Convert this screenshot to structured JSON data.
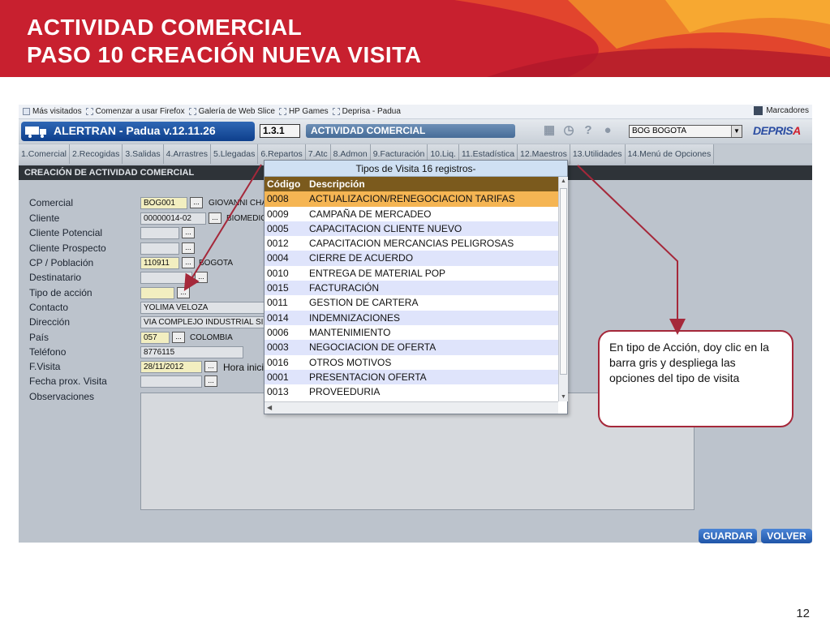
{
  "slide": {
    "title_line1": "ACTIVIDAD COMERCIAL",
    "title_line2": "PASO 10 CREACIÓN NUEVA VISITA",
    "page_number": "12"
  },
  "bookmarks": {
    "items": [
      "Más visitados",
      "Comenzar a usar Firefox",
      "Galería de Web Slice",
      "HP Games",
      "Deprisa - Padua"
    ],
    "right": "Marcadores"
  },
  "app": {
    "name": "ALERTRAN - Padua  v.12.11.26",
    "code": "1.3.1",
    "module": "ACTIVIDAD COMERCIAL",
    "city": "BOG BOGOTA",
    "brand": "DEPRIS",
    "brand_accent": "A",
    "tabs": [
      "1.Comercial",
      "2.Recogidas",
      "3.Salidas",
      "4.Arrastres",
      "5.Llegadas",
      "6.Repartos",
      "7.Atc",
      "8.Admon",
      "9.Facturación",
      "10.Liq.",
      "11.Estadística",
      "12.Maestros",
      "13.Utilidades",
      "14.Menú de Opciones"
    ],
    "section_title": "CREACIÓN DE ACTIVIDAD COMERCIAL"
  },
  "form": {
    "labels": {
      "comercial": "Comercial",
      "cliente": "Cliente",
      "cliente_potencial": "Cliente Potencial",
      "cliente_prospecto": "Cliente Prospecto",
      "cp_poblacion": "CP / Población",
      "destinatario": "Destinatario",
      "tipo_accion": "Tipo de acción",
      "contacto": "Contacto",
      "direccion": "Dirección",
      "pais": "País",
      "telefono": "Teléfono",
      "fvisita": "F.Visita",
      "fecha_prox": "Fecha prox. Visita",
      "observaciones": "Observaciones",
      "hora_inicio": "Hora inicio"
    },
    "values": {
      "comercial_code": "BOG001",
      "comercial_name": "GIOVANNI CHA",
      "cliente_code": "00000014-02",
      "cliente_name": "BIOMEDIC",
      "cp": "110911",
      "poblacion": "BOGOTA",
      "contacto": "YOLIMA VELOZA",
      "direccion": "VIA COMPLEJO INDUSTRIAL SIBER",
      "pais_code": "057",
      "pais_name": "COLOMBIA",
      "telefono": "8776115",
      "fvisita": "28/11/2012"
    },
    "lookup_button": "...",
    "guardar": "GUARDAR",
    "volver": "VOLVER"
  },
  "popup": {
    "title": "Tipos de Visita 16 registros-",
    "col_code": "Código",
    "col_desc": "Descripción",
    "rows": [
      {
        "code": "0008",
        "desc": "ACTUALIZACION/RENEGOCIACION TARIFAS"
      },
      {
        "code": "0009",
        "desc": "CAMPAÑA DE MERCADEO"
      },
      {
        "code": "0005",
        "desc": "CAPACITACION CLIENTE NUEVO"
      },
      {
        "code": "0012",
        "desc": "CAPACITACION MERCANCIAS PELIGROSAS"
      },
      {
        "code": "0004",
        "desc": "CIERRE DE ACUERDO"
      },
      {
        "code": "0010",
        "desc": "ENTREGA DE MATERIAL POP"
      },
      {
        "code": "0015",
        "desc": "FACTURACIÓN"
      },
      {
        "code": "0011",
        "desc": "GESTION DE CARTERA"
      },
      {
        "code": "0014",
        "desc": "INDEMNIZACIONES"
      },
      {
        "code": "0006",
        "desc": "MANTENIMIENTO"
      },
      {
        "code": "0003",
        "desc": "NEGOCIACION DE OFERTA"
      },
      {
        "code": "0016",
        "desc": "OTROS MOTIVOS"
      },
      {
        "code": "0001",
        "desc": "PRESENTACION OFERTA"
      },
      {
        "code": "0013",
        "desc": "PROVEEDURIA"
      }
    ]
  },
  "callout": {
    "text": "En tipo de Acción, doy clic en la barra gris y despliega las opciones del tipo de visita"
  },
  "colors": {
    "banner_red": "#c8202f",
    "callout_border": "#a5283a",
    "selected_row": "#f5b553",
    "header_row": "#7b5a1d"
  }
}
